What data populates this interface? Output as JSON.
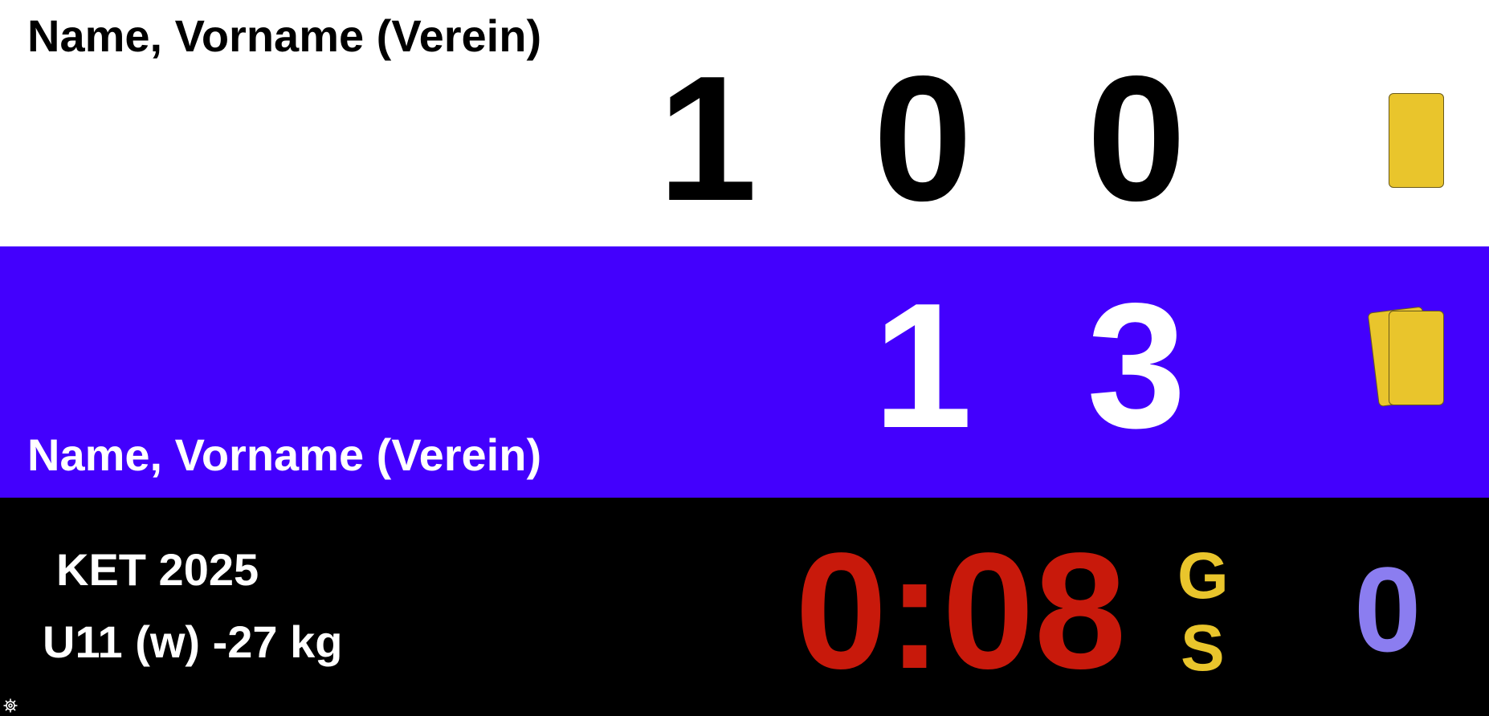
{
  "white": {
    "name": "Name, Vorname (Verein)",
    "score": [
      "1",
      "0",
      "0"
    ],
    "penalty_cards": 1
  },
  "blue": {
    "name": "Name, Vorname (Verein)",
    "score": [
      "1",
      "3"
    ],
    "penalty_cards": 2
  },
  "info": {
    "tournament": "KET 2025",
    "category": "U11 (w) -27 kg",
    "timer": "0:08",
    "golden_score_top": "G",
    "golden_score_bottom": "S",
    "osaekomi": "0"
  },
  "icons": {
    "settings": "gear-icon"
  },
  "colors": {
    "blue_panel": "#4300fd",
    "card_yellow": "#e9c52c",
    "timer_red": "#c8190b",
    "osaekomi_purple": "#8b7df0"
  }
}
